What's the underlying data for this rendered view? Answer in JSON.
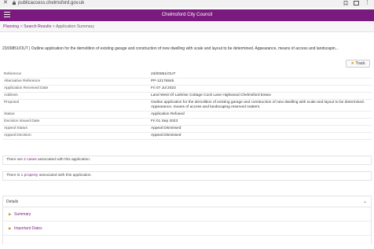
{
  "browser": {
    "url": "publicaccess.chelmsford.gov.uk",
    "close_glyph": "✕",
    "menu_glyph": "⋮"
  },
  "header": {
    "title": "Chelmsford City Council"
  },
  "breadcrumb": {
    "planning": "Planning",
    "sep1": " > ",
    "search_results": "Search Results",
    "sep2": " > ",
    "current": "Application Summary"
  },
  "description": "23/00851/OUT | Outline application for the demolition of existing garage and construction of new dwelling with scale and layout to be determined. Appearance, means of access and landscapin...",
  "track": {
    "label": "Track",
    "star": "★"
  },
  "details": [
    {
      "label": "Reference",
      "value": "23/00851/OUT"
    },
    {
      "label": "Alternative Reference",
      "value": "PP-12176845"
    },
    {
      "label": "Application Received Date",
      "value": "Fri 07 Jul 2023"
    },
    {
      "label": "Address",
      "value": "Land West Of Larkrise Cottage Cock Lane Highwood Chelmsford Essex"
    },
    {
      "label": "Proposal",
      "value": "Outline application for the demolition of existing garage and construction of new dwelling with scale and layout to be determined. Appearance, means of access and landscaping reserved matters."
    },
    {
      "label": "Status",
      "value": "Application Refused"
    },
    {
      "label": "Decision Issued Date",
      "value": "Fri 01 Sep 2023"
    },
    {
      "label": "Appeal Status",
      "value": "Appeal Dismissed"
    },
    {
      "label": "Appeal Decision",
      "value": "Appeal Dismissed"
    }
  ],
  "cases_box": {
    "prefix": "There are ",
    "link": "2 cases",
    "suffix": " associated with this application."
  },
  "property_box": {
    "prefix": "There is ",
    "link": "1 property",
    "suffix": " associated with this application."
  },
  "accordion": {
    "title": "Details",
    "chevron": "⌄",
    "items": [
      {
        "label": "Summary"
      },
      {
        "label": "Important Dates"
      }
    ],
    "tri": "▶"
  },
  "colors": {
    "brand": "#7a1a7e",
    "star": "#e4a21b"
  }
}
